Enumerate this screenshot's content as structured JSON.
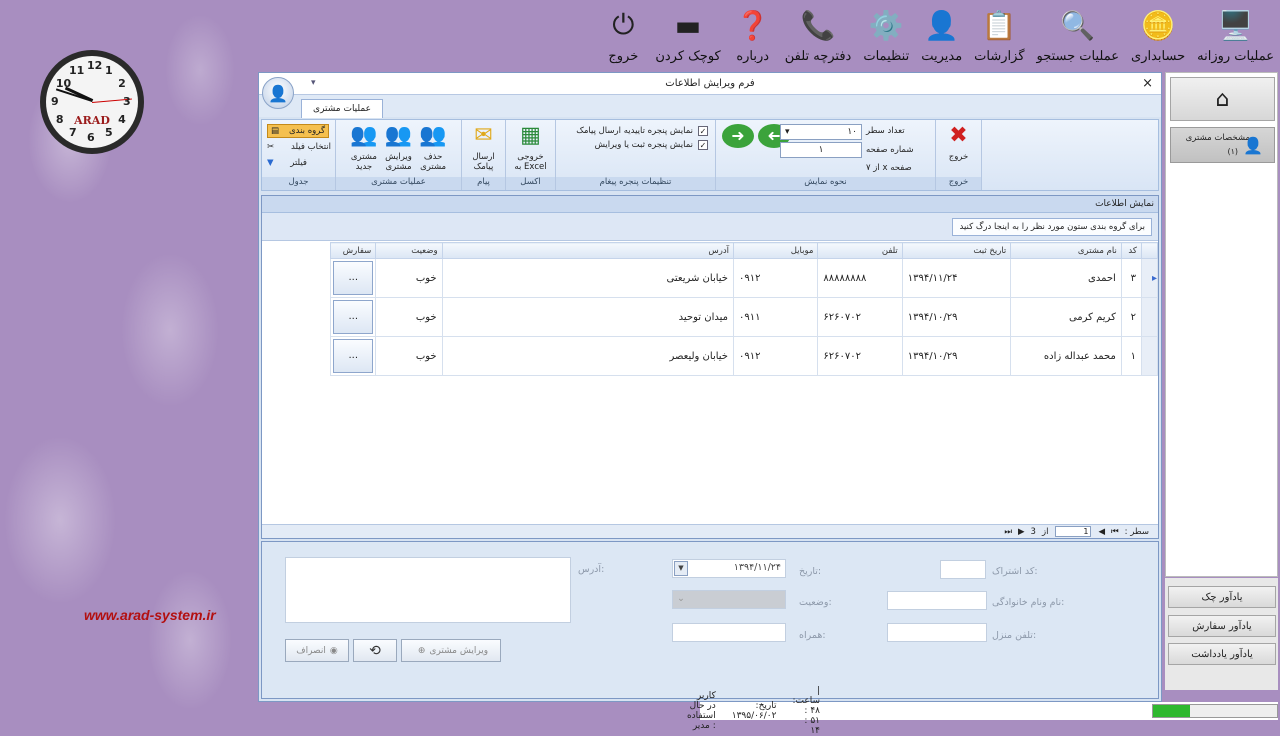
{
  "top_menu": [
    {
      "label": "عملیات روزانه",
      "icon": "daily-ops-icon",
      "glyph": "🖥️"
    },
    {
      "label": "حسابداری",
      "icon": "coins-icon",
      "glyph": "🪙"
    },
    {
      "label": "عملیات جستجو",
      "icon": "magnifier-icon",
      "glyph": "🔍"
    },
    {
      "label": "گزارشات",
      "icon": "report-icon",
      "glyph": "📋"
    },
    {
      "label": "مدیریت",
      "icon": "manager-icon",
      "glyph": "👤"
    },
    {
      "label": "تنظیمات",
      "icon": "gear-icon",
      "glyph": "⚙️"
    },
    {
      "label": "دفترچه تلفن",
      "icon": "phone-icon",
      "glyph": "📞"
    },
    {
      "label": "درباره",
      "icon": "help-icon",
      "glyph": "❓"
    },
    {
      "label": "کوچک کردن",
      "icon": "minimize-icon",
      "glyph": "▬"
    },
    {
      "label": "خروج",
      "icon": "power-icon",
      "glyph": "⏻"
    }
  ],
  "clock": {
    "brand": "ARAD",
    "numbers": [
      "12",
      "1",
      "2",
      "3",
      "4",
      "5",
      "6",
      "7",
      "8",
      "9",
      "10",
      "11"
    ]
  },
  "website": "www.arad-system.ir",
  "window": {
    "title": "فرم ویرایش اطلاعات",
    "close": "×",
    "quick_access": "▾",
    "tab": "عملیات مشتری"
  },
  "ribbon": {
    "exit": {
      "label": "خروج",
      "group": "خروج"
    },
    "display": {
      "group": "نحوه نمایش",
      "rows_label": "تعداد سطر",
      "rows_value": "۱۰",
      "page_label": "شماره صفحه",
      "page_value": "۱",
      "page_of": "۷ از x صفحه"
    },
    "message_settings": {
      "group": "تنظیمات پنجره پیغام",
      "opt1": "نمایش پنجره تاییدیه ارسال پیامک",
      "opt2": "نمایش پنجره ثبت یا ویرایش",
      "check": "✓"
    },
    "excel": {
      "group": "اکسل",
      "label1": "خروجی",
      "label2": "به Excel"
    },
    "message": {
      "group": "پیام",
      "label1": "ارسال",
      "label2": "پیامک"
    },
    "customer_ops": {
      "group": "عملیات مشتری",
      "delete1": "حذف",
      "delete2": "مشتری",
      "edit1": "ویرایش",
      "edit2": "مشتری",
      "new1": "مشتری",
      "new2": "جدید"
    },
    "table_group": {
      "group": "جدول",
      "grouping": "گروه بندی",
      "field_select": "انتخاب فیلد",
      "filter": "فیلتر"
    }
  },
  "grid": {
    "panel_title": "نمایش اطلاعات",
    "group_hint": "برای گروه بندی ستون مورد نظر را به اینجا درگ کنید",
    "columns": [
      "کد",
      "نام مشتری",
      "تاریخ ثبت",
      "تلفن",
      "موبایل",
      "آدرس",
      "وضعیت",
      "سفارش"
    ],
    "rows": [
      {
        "code": "۳",
        "name": "احمدی",
        "date": "۱۳۹۴/۱۱/۲۴",
        "phone": "۸۸۸۸۸۸۸۸",
        "mobile": "۰۹۱۲",
        "address": "خیابان شریعتی",
        "status": "خوب",
        "order": "..."
      },
      {
        "code": "۲",
        "name": "کریم کرمی",
        "date": "۱۳۹۴/۱۰/۲۹",
        "phone": "۶۲۶۰۷۰۲",
        "mobile": "۰۹۱۱",
        "address": "میدان توحید",
        "status": "خوب",
        "order": "..."
      },
      {
        "code": "۱",
        "name": "محمد عبداله زاده",
        "date": "۱۳۹۴/۱۰/۲۹",
        "phone": "۶۲۶۰۷۰۲",
        "mobile": "۰۹۱۲",
        "address": "خیابان ولیعصر",
        "status": "خوب",
        "order": "..."
      }
    ],
    "pager": {
      "row_label": "سطر :",
      "current": "1",
      "of": "از",
      "total": "3"
    }
  },
  "edit_form": {
    "sub_code": "کد اشتراک:",
    "family": "نام ونام خانوادگی:",
    "home_phone": "تلفن منزل:",
    "date": "تاریخ:",
    "date_value": "۱۳۹۴/۱۱/۲۴",
    "status": "وضعیت:",
    "mobile": "همراه:",
    "address": "آدرس:",
    "edit_button": "ویرایش مشتری",
    "cancel_button": "انصراف"
  },
  "right_panel": {
    "customer_spec": "مشخصات مشتری",
    "customer_count": "(۱)"
  },
  "reminders": [
    "یادآور چک",
    "یادآور سفارش",
    "یادآور یادداشت"
  ],
  "status": {
    "user": "کاربر در حال استفاده : مدیر",
    "date": "تاریخ: ۱۳۹۵/۰۶/۰۲",
    "time": "| ساعت: ۴۸ : ۵۱ : ۱۴"
  },
  "progress": 0.3
}
